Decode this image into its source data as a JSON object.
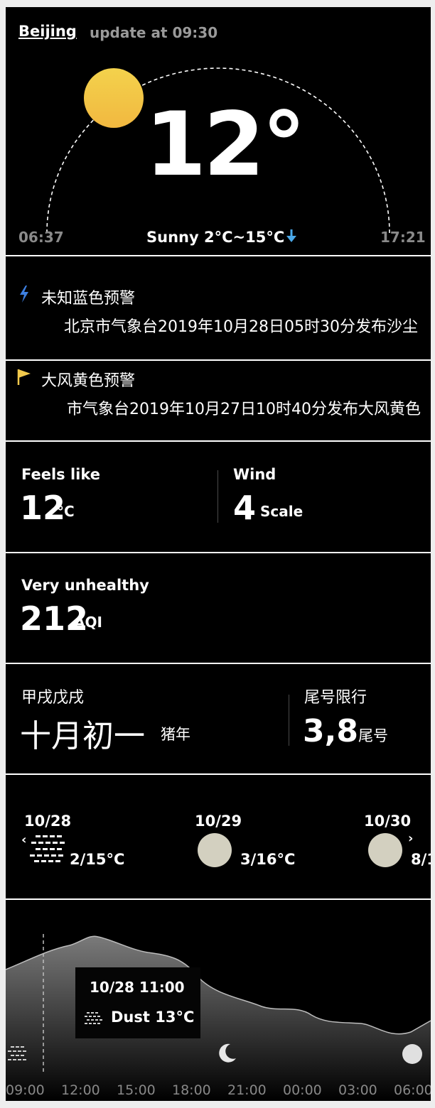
{
  "header": {
    "city": "Beijing",
    "update_text": "update at 09:30",
    "temperature": "12°",
    "sunrise": "06:37",
    "sunset": "17:21",
    "condition": "Sunny 2°C~15°C"
  },
  "warnings": [
    {
      "title": "未知蓝色预警",
      "text": "北京市气象台2019年10月28日05时30分发布沙尘",
      "icon": "lightning-icon",
      "color": "#3d7fe0"
    },
    {
      "title": "大风黄色预警",
      "text": "市气象台2019年10月27日10时40分发布大风黄色",
      "icon": "flag-icon",
      "color": "#f2c94c"
    }
  ],
  "feels": {
    "label": "Feels like",
    "value": "12",
    "unit": "°C"
  },
  "wind": {
    "label": "Wind",
    "value": "4",
    "unit": "Scale"
  },
  "aqi": {
    "label": "Very unhealthy",
    "value": "212",
    "unit": "AQI"
  },
  "lunar": {
    "ganzhi": "甲戌戊戌",
    "date": "十月初一",
    "zodiac": "猪年"
  },
  "traffic": {
    "label": "尾号限行",
    "value": "3,8",
    "unit": "尾号"
  },
  "forecast": [
    {
      "date": "10/28",
      "temp": "2/15°C",
      "icon": "dust-icon"
    },
    {
      "date": "10/29",
      "temp": "3/16°C",
      "icon": "moon-icon"
    },
    {
      "date": "10/30",
      "temp": "8/1",
      "icon": "moon-icon"
    }
  ],
  "hourly": {
    "hours": [
      "09:00",
      "12:00",
      "15:00",
      "18:00",
      "21:00",
      "00:00",
      "03:00",
      "06:00"
    ],
    "tooltip_time": "10/28 11:00",
    "tooltip_condition": "Dust 13°C"
  },
  "colors": {
    "accent_blue": "#3d7fe0",
    "accent_yellow": "#f2c94c",
    "sun": "#f2c84a"
  }
}
